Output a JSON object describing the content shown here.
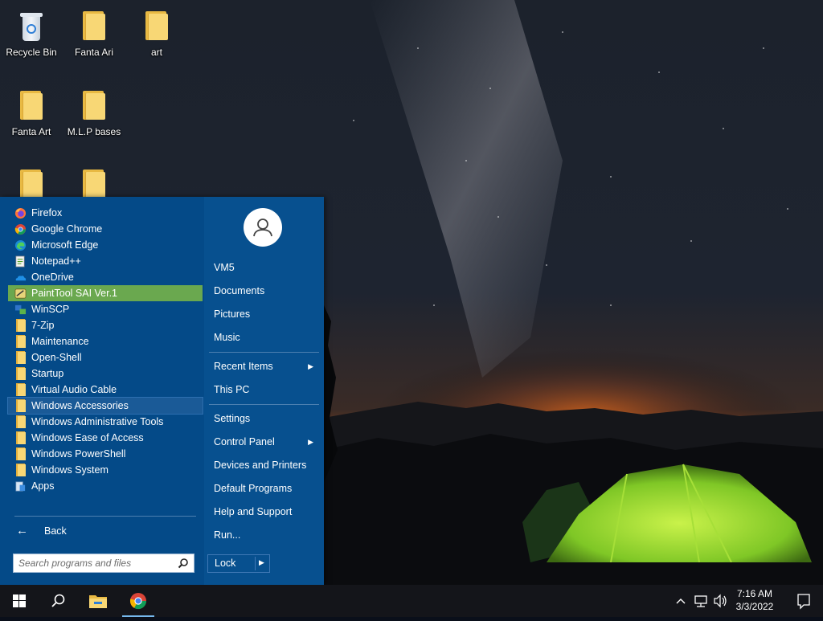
{
  "desktop": {
    "icons": [
      {
        "label": "Recycle Bin"
      },
      {
        "label": "Fanta Ari"
      },
      {
        "label": "art"
      },
      {
        "label": "Fanta Art"
      },
      {
        "label": "M.L.P bases"
      },
      {
        "label": ""
      },
      {
        "label": ""
      }
    ]
  },
  "start_menu": {
    "programs": [
      {
        "label": "Firefox",
        "icon": "firefox-icon"
      },
      {
        "label": "Google Chrome",
        "icon": "chrome-icon"
      },
      {
        "label": "Microsoft Edge",
        "icon": "edge-icon"
      },
      {
        "label": "Notepad++",
        "icon": "notepadpp-icon"
      },
      {
        "label": "OneDrive",
        "icon": "onedrive-icon"
      },
      {
        "label": "PaintTool SAI Ver.1",
        "icon": "painttool-sai-icon"
      },
      {
        "label": "WinSCP",
        "icon": "winscp-icon"
      },
      {
        "label": "7-Zip",
        "icon": "folder-icon"
      },
      {
        "label": "Maintenance",
        "icon": "folder-icon"
      },
      {
        "label": "Open-Shell",
        "icon": "folder-icon"
      },
      {
        "label": "Startup",
        "icon": "folder-icon"
      },
      {
        "label": "Virtual Audio Cable",
        "icon": "folder-icon"
      },
      {
        "label": "Windows Accessories",
        "icon": "folder-icon"
      },
      {
        "label": "Windows Administrative Tools",
        "icon": "folder-icon"
      },
      {
        "label": "Windows Ease of Access",
        "icon": "folder-icon"
      },
      {
        "label": "Windows PowerShell",
        "icon": "folder-icon"
      },
      {
        "label": "Windows System",
        "icon": "folder-icon"
      },
      {
        "label": "Apps",
        "icon": "apps-icon"
      }
    ],
    "back_label": "Back",
    "search_placeholder": "Search programs and files",
    "places": {
      "user": "VM5",
      "documents": "Documents",
      "pictures": "Pictures",
      "music": "Music",
      "recent_items": "Recent Items",
      "this_pc": "This PC",
      "settings": "Settings",
      "control_panel": "Control Panel",
      "devices_printers": "Devices and Printers",
      "default_programs": "Default Programs",
      "help_support": "Help and Support",
      "run": "Run..."
    },
    "lock_label": "Lock",
    "highlight_color": "#6aa84f",
    "background_color": "#07508f"
  },
  "taskbar": {
    "time": "7:16 AM",
    "date": "3/3/2022",
    "accent_color": "#76b9ed"
  }
}
